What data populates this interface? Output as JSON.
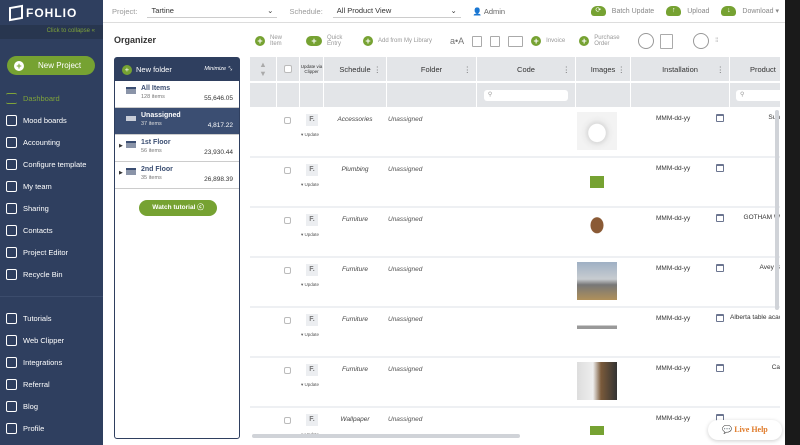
{
  "brand": "FOHLIO",
  "sidebar": {
    "collapse": "Click to collapse",
    "new_project": "New Project",
    "items": [
      {
        "label": "Dashboard",
        "icon": "menu-icon"
      },
      {
        "label": "Mood boards",
        "icon": "moodboard-icon"
      },
      {
        "label": "Accounting",
        "icon": "accounting-icon"
      },
      {
        "label": "Configure template",
        "icon": "gear-icon"
      },
      {
        "label": "My team",
        "icon": "team-icon"
      },
      {
        "label": "Sharing",
        "icon": "share-icon"
      },
      {
        "label": "Contacts",
        "icon": "contacts-icon"
      },
      {
        "label": "Project Editor",
        "icon": "edit-icon"
      },
      {
        "label": "Recycle Bin",
        "icon": "recycle-icon"
      }
    ],
    "bottom": [
      {
        "label": "Tutorials",
        "icon": "info-icon"
      },
      {
        "label": "Web Clipper",
        "icon": "web-clipper-icon"
      },
      {
        "label": "Integrations",
        "icon": "puzzle-icon"
      },
      {
        "label": "Referral",
        "icon": "dollar-icon"
      },
      {
        "label": "Blog",
        "icon": "blog-icon"
      },
      {
        "label": "Profile",
        "icon": "profile-icon"
      }
    ]
  },
  "topbar": {
    "project_label": "Project:",
    "project": "Tartine",
    "schedule_label": "Schedule:",
    "schedule": "All Product View",
    "user": "Admin",
    "batch_update": "Batch Update",
    "upload": "Upload",
    "download": "Download"
  },
  "organizer": {
    "title": "Organizer",
    "new_folder": "New folder",
    "minimize": "Minimize",
    "watch": "Watch tutorial",
    "folders": [
      {
        "name": "All Items",
        "count": "128 items",
        "amount": "55,646.05"
      },
      {
        "name": "Unassigned",
        "count": "37 items",
        "amount": "4,817.22"
      },
      {
        "name": "1st Floor",
        "count": "56 items",
        "amount": "23,930.44"
      },
      {
        "name": "2nd Floor",
        "count": "35 items",
        "amount": "26,898.39"
      }
    ]
  },
  "toolbar": {
    "new_item": "New Item",
    "quick_entry": "Quick Entry",
    "add_library": "Add from My Library",
    "font_size": "a•A",
    "invoice": "Invoice",
    "purchase_order": "Purchase Order"
  },
  "table": {
    "columns": {
      "update_clipper": "Update via Clipper",
      "schedule": "Schedule",
      "folder": "Folder",
      "code": "Code",
      "images": "Images",
      "installation": "Installation",
      "product": "Product"
    },
    "update_label": "Update",
    "clip_label": "F.",
    "rows": [
      {
        "schedule": "Accessories",
        "folder": "Unassigned",
        "installation": "MMM-dd-yy",
        "product": "Sun",
        "image": "bathtub"
      },
      {
        "schedule": "Plumbing",
        "folder": "Unassigned",
        "installation": "MMM-dd-yy",
        "product": "",
        "image": "add"
      },
      {
        "schedule": "Furniture",
        "folder": "Unassigned",
        "installation": "MMM-dd-yy",
        "product": "GOTHAM W",
        "image": "chair"
      },
      {
        "schedule": "Furniture",
        "folder": "Unassigned",
        "installation": "MMM-dd-yy",
        "product": "Avey B",
        "image": "bedroom"
      },
      {
        "schedule": "Furniture",
        "folder": "Unassigned",
        "installation": "MMM-dd-yy",
        "product": "Alberta table acacia timb poly-ce",
        "image": "table"
      },
      {
        "schedule": "Furniture",
        "folder": "Unassigned",
        "installation": "MMM-dd-yy",
        "product": "Ca",
        "image": "office"
      },
      {
        "schedule": "Wallpaper",
        "folder": "Unassigned",
        "installation": "MMM-dd-yy",
        "product": "",
        "image": "add"
      }
    ]
  },
  "live_help": "Live Help",
  "colors": {
    "sidebar": "#2f3f5f",
    "accent": "#76a232",
    "live_help": "#e07b2a"
  }
}
